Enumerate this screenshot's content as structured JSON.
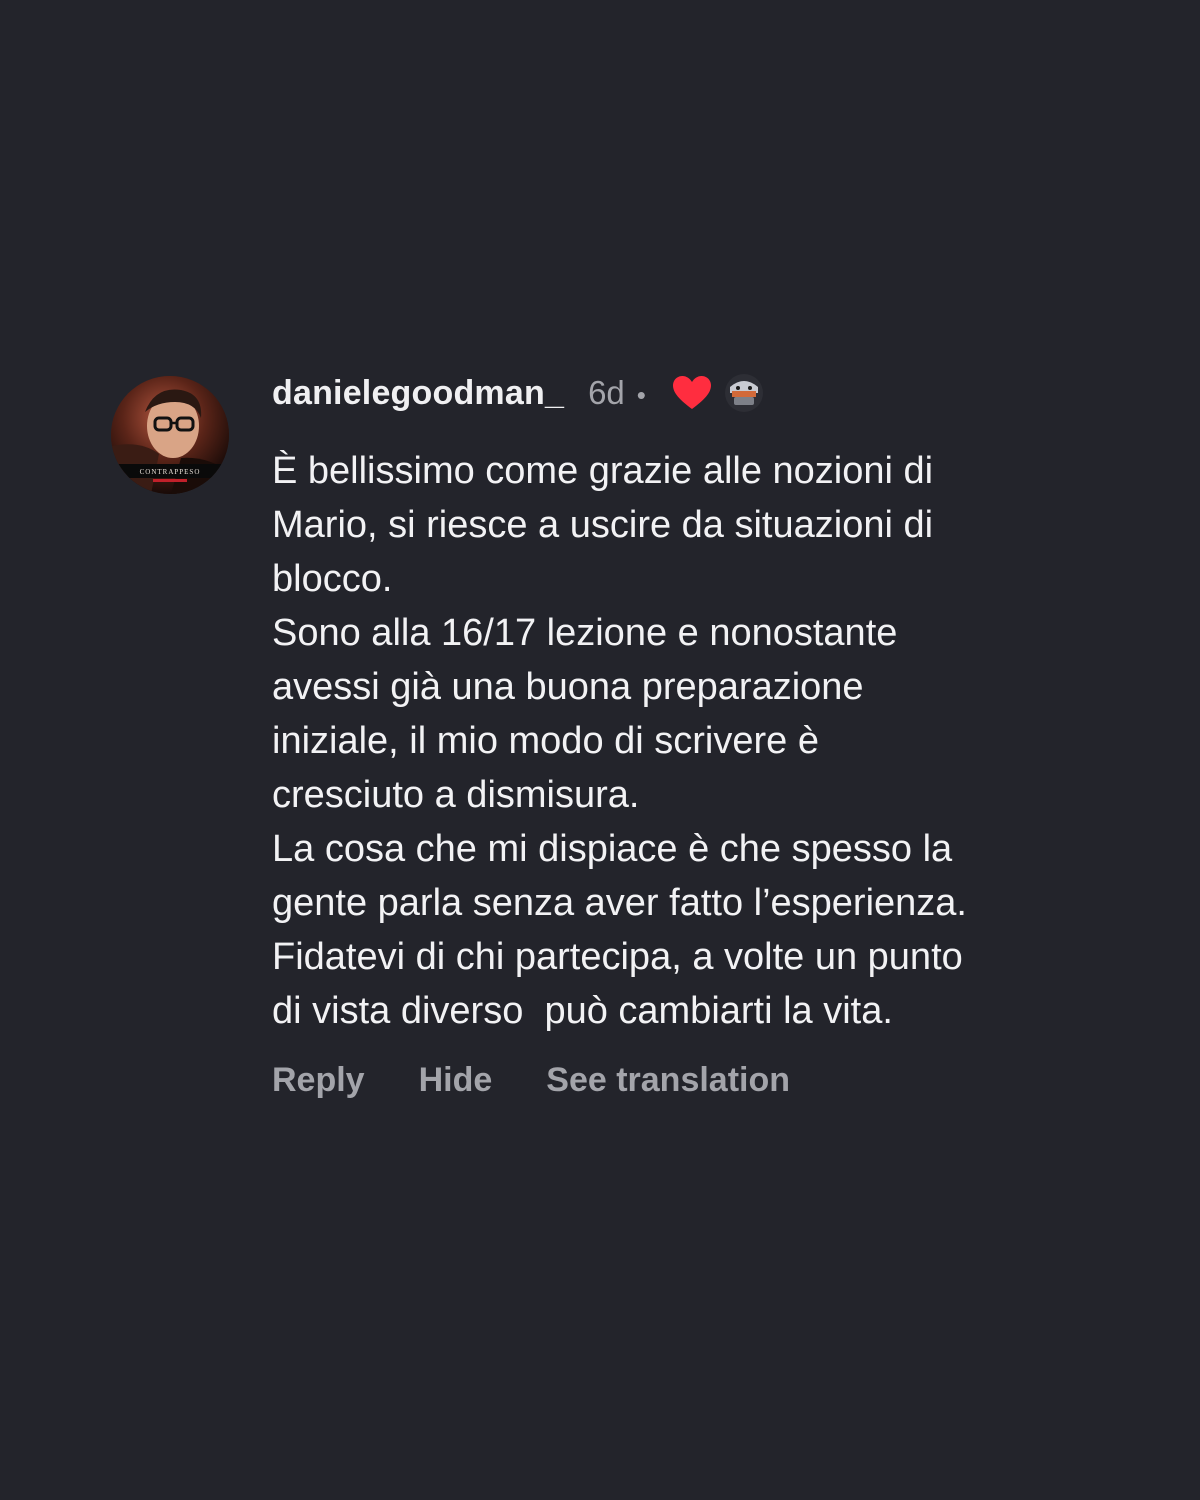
{
  "comment": {
    "avatar_text": "CONTRAPPESO",
    "username": "danielegoodman_",
    "time": "6d",
    "separator": "•",
    "liked_by_author": true,
    "heart_color": "#ff2d3f",
    "icons": {
      "avatar": "user-avatar-icon",
      "heart": "heart-icon",
      "author_avatar": "author-avatar-icon"
    },
    "text_lines": [
      "È bellissimo come grazie alle nozioni di",
      "Mario, si riesce a uscire da situazioni di",
      "blocco.",
      "Sono alla 16/17 lezione e nonostante",
      "avessi già una buona preparazione",
      "iniziale, il mio modo di scrivere è",
      "cresciuto a dismisura.",
      "La cosa che mi dispiace è che spesso la",
      "gente parla senza aver fatto l’esperienza.",
      "Fidatevi di chi partecipa, a volte un punto",
      "di vista diverso  può cambiarti la vita."
    ],
    "actions": {
      "reply": "Reply",
      "hide": "Hide",
      "see_translation": "See translation"
    }
  }
}
